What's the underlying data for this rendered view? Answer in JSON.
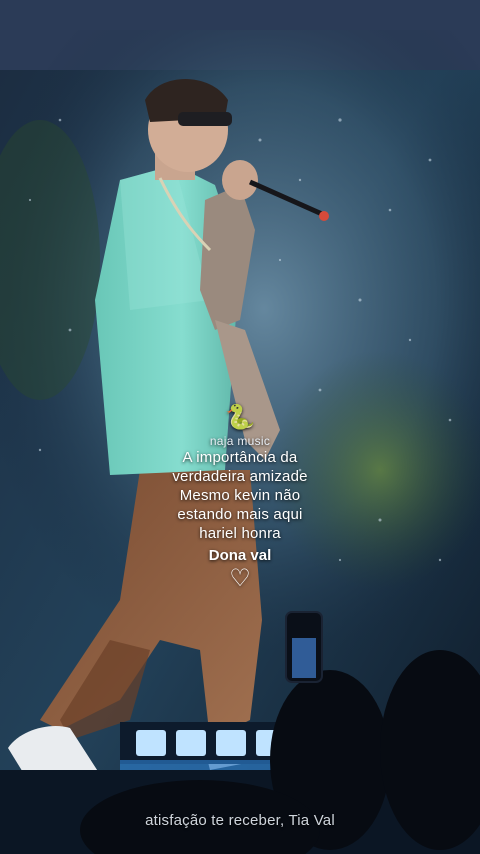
{
  "caption": {
    "emoji": "🐍",
    "tag": "naja music",
    "lines": [
      "A importância da",
      "verdadeira amizade",
      "Mesmo kevin não",
      "estando mais aqui",
      "hariel honra"
    ],
    "name": "Dona val",
    "heart": "♡"
  },
  "subtitle": "atisfação te receber, Tia Val",
  "colors": {
    "shirt": "#7fd6c6",
    "pants": "#8a5a3c",
    "background": "#0b1320",
    "stage_lights": "#6fb8ff"
  }
}
